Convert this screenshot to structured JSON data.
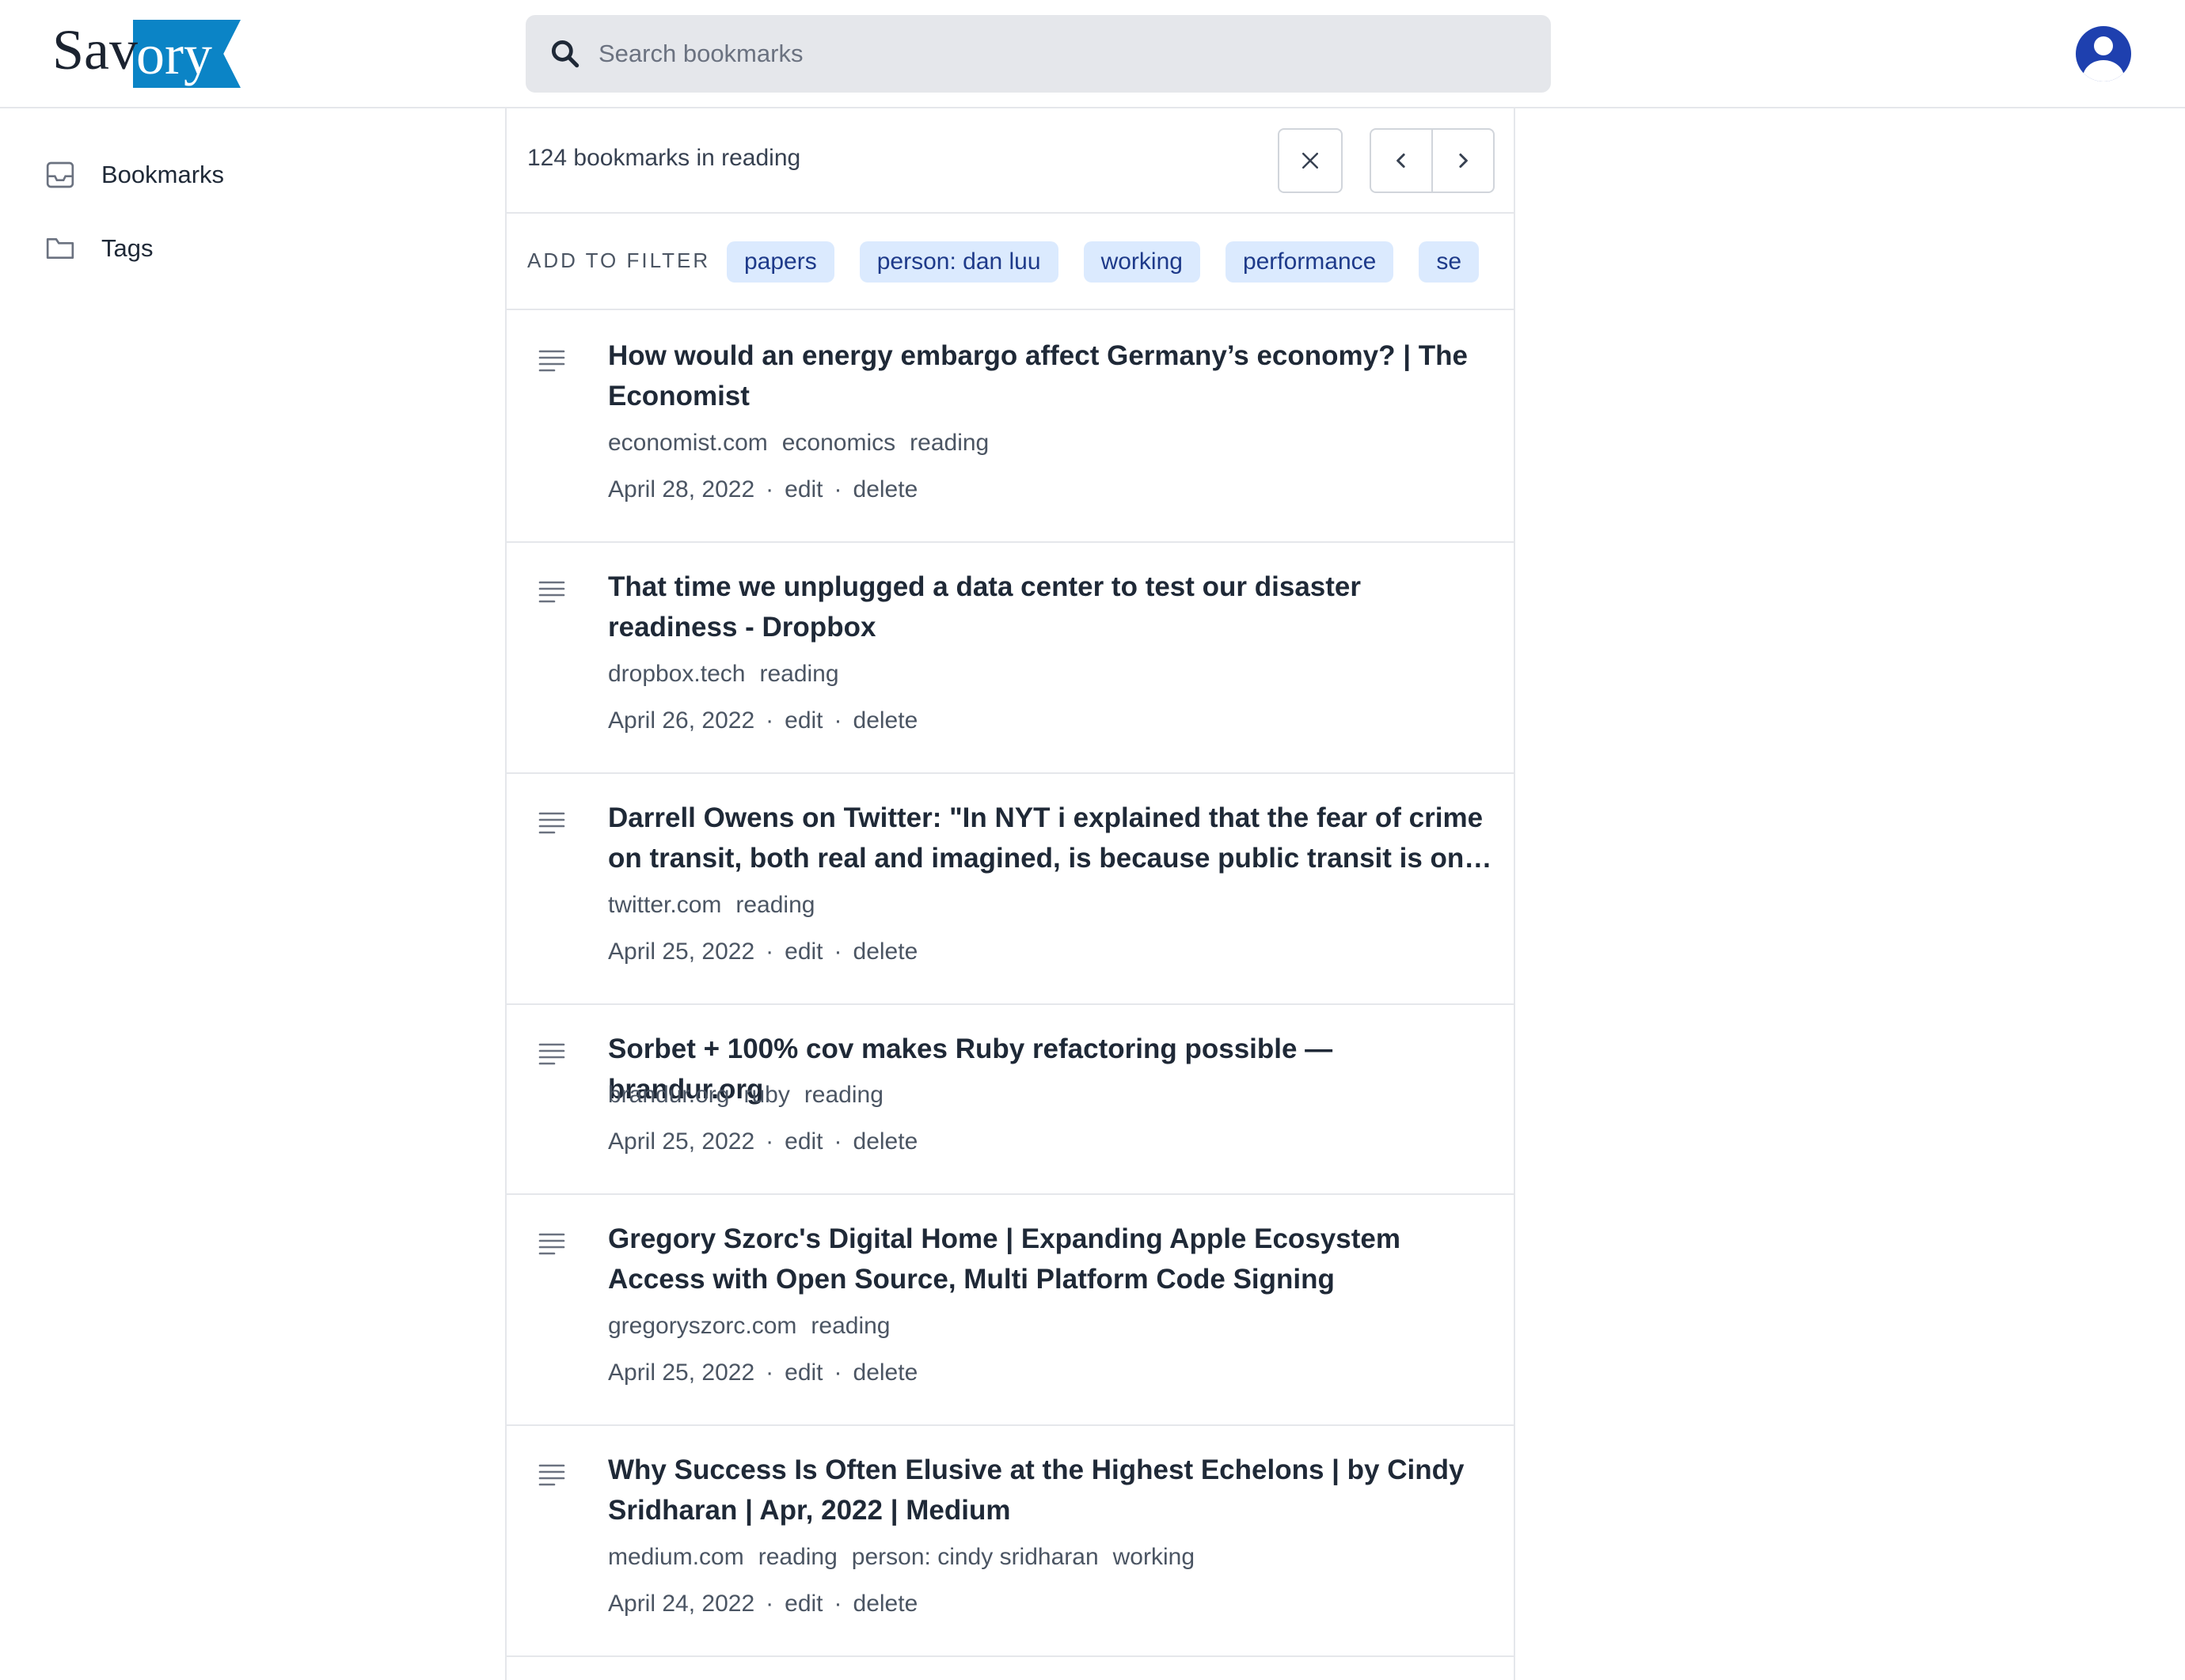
{
  "app": {
    "logo_text_left": "Sav",
    "logo_text_right": "ory",
    "brand_color": "#0b84c6"
  },
  "search": {
    "placeholder": "Search bookmarks",
    "value": ""
  },
  "sidebar": {
    "items": [
      {
        "label": "Bookmarks",
        "icon": "inbox-icon"
      },
      {
        "label": "Tags",
        "icon": "folder-icon"
      }
    ]
  },
  "list": {
    "count_text": "124 bookmarks in reading",
    "filter_label": "ADD TO FILTER",
    "filter_chips": [
      "papers",
      "person: dan luu",
      "working",
      "performance",
      "se"
    ],
    "actions": {
      "edit": "edit",
      "delete": "delete"
    },
    "bookmarks": [
      {
        "title": "How would an energy embargo affect Germany’s economy? | The Economist",
        "domain": "economist.com",
        "tags": [
          "economics",
          "reading"
        ],
        "date": "April 28, 2022"
      },
      {
        "title": "That time we unplugged a data center to test our disaster readiness - Dropbox",
        "domain": "dropbox.tech",
        "tags": [
          "reading"
        ],
        "date": "April 26, 2022"
      },
      {
        "title": "Darrell Owens on Twitter: \"In NYT i explained that the fear of crime on transit, both real and imagined, is because public transit is one ...",
        "domain": "twitter.com",
        "tags": [
          "reading"
        ],
        "date": "April 25, 2022"
      },
      {
        "title": "Sorbet + 100% cov makes Ruby refactoring possible — brandur.org",
        "domain": "brandur.org",
        "tags": [
          "ruby",
          "reading"
        ],
        "date": "April 25, 2022"
      },
      {
        "title": "Gregory Szorc's Digital Home | Expanding Apple Ecosystem Access with Open Source, Multi Platform Code Signing",
        "domain": "gregoryszorc.com",
        "tags": [
          "reading"
        ],
        "date": "April 25, 2022"
      },
      {
        "title": "Why Success Is Often Elusive at the Highest Echelons | by Cindy Sridharan | Apr, 2022 | Medium",
        "domain": "medium.com",
        "tags": [
          "reading",
          "person: cindy sridharan",
          "working"
        ],
        "date": "April 24, 2022"
      }
    ]
  }
}
